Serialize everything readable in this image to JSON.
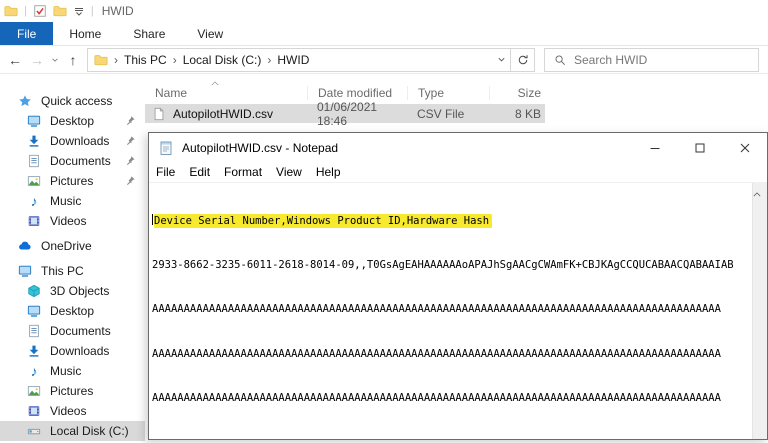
{
  "glyphs": {
    "qat_sep": "|",
    "back": "←",
    "forward": "→",
    "up": "↑",
    "breadcrumb_sep": "›",
    "music": "♪"
  },
  "colors": {
    "ribbon_file_tab_blue": "#1566b9",
    "sidebar_icon_blue": "#1673c4",
    "selection_gray": "#d9d9d9",
    "row_selection_gray": "#dcdcdc",
    "notepad_highlight_yellow": "#f7ea2e"
  },
  "explorer": {
    "title": "HWID",
    "tabs": [
      {
        "label": "File",
        "active": true
      },
      {
        "label": "Home",
        "active": false
      },
      {
        "label": "Share",
        "active": false
      },
      {
        "label": "View",
        "active": false
      }
    ],
    "breadcrumb": {
      "items": [
        "This PC",
        "Local Disk (C:)",
        "HWID"
      ]
    },
    "search": {
      "placeholder": "Search HWID"
    },
    "sidebar": {
      "sections": [
        {
          "label": "Quick access",
          "icon": "star-icon",
          "items": [
            {
              "label": "Desktop",
              "icon": "monitor-icon",
              "pinned": true
            },
            {
              "label": "Downloads",
              "icon": "download-icon",
              "pinned": true
            },
            {
              "label": "Documents",
              "icon": "document-icon",
              "pinned": true
            },
            {
              "label": "Pictures",
              "icon": "picture-icon",
              "pinned": true
            },
            {
              "label": "Music",
              "icon": "music-icon",
              "pinned": false
            },
            {
              "label": "Videos",
              "icon": "film-icon",
              "pinned": false
            }
          ]
        },
        {
          "label": "OneDrive",
          "icon": "cloud-icon",
          "items": []
        },
        {
          "label": "This PC",
          "icon": "monitor-icon",
          "items": [
            {
              "label": "3D Objects",
              "icon": "cube-icon"
            },
            {
              "label": "Desktop",
              "icon": "monitor-icon"
            },
            {
              "label": "Documents",
              "icon": "document-icon"
            },
            {
              "label": "Downloads",
              "icon": "download-icon"
            },
            {
              "label": "Music",
              "icon": "music-icon"
            },
            {
              "label": "Pictures",
              "icon": "picture-icon"
            },
            {
              "label": "Videos",
              "icon": "film-icon"
            },
            {
              "label": "Local Disk (C:)",
              "icon": "drive-icon",
              "selected": true
            }
          ]
        }
      ]
    },
    "file_list": {
      "columns": [
        "Name",
        "Date modified",
        "Type",
        "Size"
      ],
      "rows": [
        {
          "name": "AutopilotHWID.csv",
          "date_modified": "01/06/2021 18:46",
          "type": "CSV File",
          "size": "8 KB",
          "selected": true
        }
      ]
    }
  },
  "notepad": {
    "title": "AutopilotHWID.csv - Notepad",
    "menu": [
      "File",
      "Edit",
      "Format",
      "View",
      "Help"
    ],
    "content": {
      "header_line": "Device Serial Number,Windows Product ID,Hardware Hash",
      "lines": [
        "2933-8662-3235-6011-2618-8014-09,,T0GsAgEAHAAAAAAoAPAJhSgAACgCWAmFK+CBJKAgCCQUCABAACQABAAIAB",
        "AAAAAAAAAAAAAAAAAAAAAAAAAAAAAAAAAAAAAAAAAAAAAAAAAAAAAAAAAAAAAAAAAAAAAAAAAAAAAAAAAAAAAAAAAA",
        "AAAAAAAAAAAAAAAAAAAAAAAAAAAAAAAAAAAAAAAAAAAAAAAAAAAAAAAAAAAAAAAAAAAAAAAAAAAAAAAAAAAAAAAAAA",
        "AAAAAAAAAAAAAAAAAAAAAAAAAAAAAAAAAAAAAAAAAAAAAAAAAAAAAAAAAAAAAAAAAAAAAAAAAAAAAAAAAAAAAAAAAA"
      ]
    }
  }
}
